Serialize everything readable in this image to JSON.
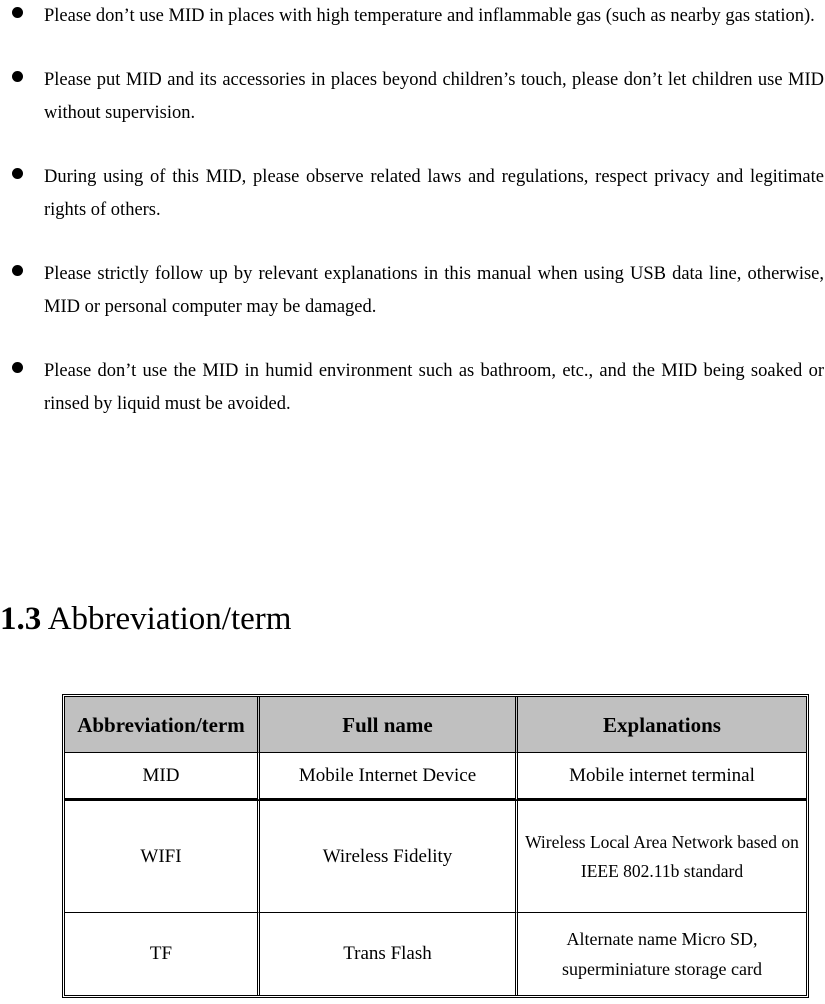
{
  "document": {
    "bullets": [
      {
        "marker": "bullet-dot",
        "text": "Please don’t use MID in places with high temperature and inflammable gas (such as nearby gas station)."
      },
      {
        "marker": "bullet-dot",
        "text": "Please put MID and its accessories in places beyond children’s touch, please don’t let children use MID without supervision."
      },
      {
        "marker": "bullet-dot",
        "text": "During using of this MID, please observe related laws and regulations, respect privacy and legitimate rights of others."
      },
      {
        "marker": "bullet-dot",
        "text": "Please strictly follow up by relevant explanations in this manual when using USB data line, otherwise, MID or personal computer may be damaged."
      },
      {
        "marker": "bullet-dot",
        "text": "Please don’t use the MID in humid environment such as bathroom, etc., and the MID being soaked or rinsed by liquid must be avoided."
      }
    ],
    "heading": {
      "number": "1.3",
      "title": "Abbreviation/term"
    },
    "table": {
      "header_background": "#c0c0c0",
      "columns": [
        "Abbreviation/term",
        "Full name",
        "Explanations"
      ],
      "rows": [
        {
          "abbreviation": "MID",
          "full_name": "Mobile Internet Device",
          "explanation": "Mobile internet terminal"
        },
        {
          "abbreviation": "WIFI",
          "full_name": "Wireless Fidelity",
          "explanation": "Wireless Local Area Network based on IEEE 802.11b standard"
        },
        {
          "abbreviation": "TF",
          "full_name": "Trans Flash",
          "explanation": "Alternate name Micro SD, superminiature storage card"
        }
      ]
    }
  }
}
